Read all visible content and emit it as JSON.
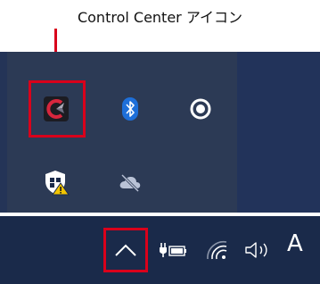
{
  "annotation": {
    "label": "Control Center アイコン"
  },
  "tray": {
    "icons": [
      {
        "name": "control-center-icon"
      },
      {
        "name": "bluetooth-icon"
      },
      {
        "name": "record-icon"
      },
      {
        "name": "windows-security-icon"
      },
      {
        "name": "onedrive-offline-icon"
      }
    ]
  },
  "taskbar": {
    "chevron": "show-hidden-icons",
    "ime_text": "A"
  },
  "colors": {
    "highlight": "#d9001b",
    "tray_bg": "#2c3a55",
    "taskbar_bg": "#1a2a4a",
    "bluetooth": "#1e6fd9",
    "shield_warning": "#f2c400"
  }
}
